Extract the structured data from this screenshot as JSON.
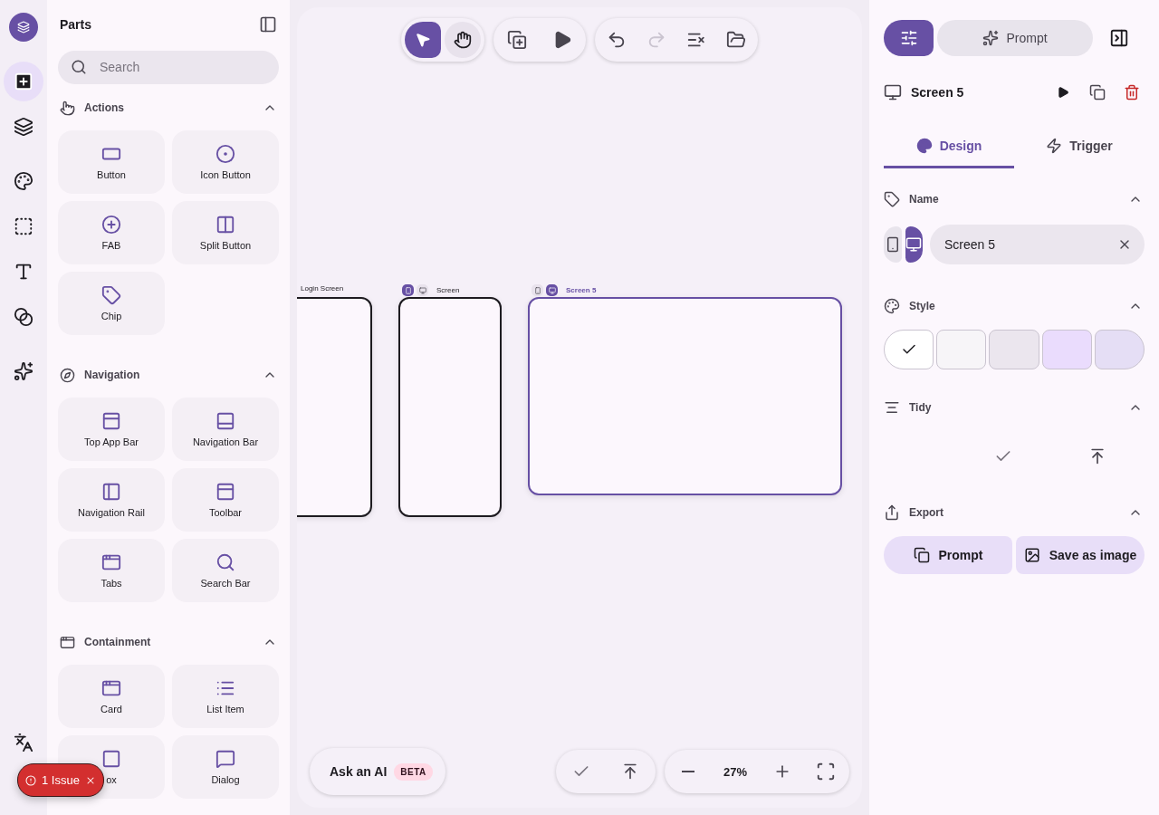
{
  "rail": {
    "items": [
      {
        "selected": true
      },
      {
        "selected": false
      },
      {
        "selected": false
      },
      {
        "selected": false
      },
      {
        "selected": false
      },
      {
        "selected": false
      },
      {
        "selected": false
      }
    ]
  },
  "parts": {
    "title": "Parts",
    "search": {
      "placeholder": "Search"
    },
    "sections": [
      {
        "title": "Actions",
        "expanded": true,
        "items": [
          {
            "label": "Button"
          },
          {
            "label": "Icon Button"
          },
          {
            "label": "FAB"
          },
          {
            "label": "Split Button"
          },
          {
            "label": "Chip"
          }
        ]
      },
      {
        "title": "Navigation",
        "expanded": true,
        "items": [
          {
            "label": "Top App Bar"
          },
          {
            "label": "Navigation Bar"
          },
          {
            "label": "Navigation Rail"
          },
          {
            "label": "Toolbar"
          },
          {
            "label": "Tabs"
          },
          {
            "label": "Search Bar"
          }
        ]
      },
      {
        "title": "Containment",
        "expanded": true,
        "items": [
          {
            "label": "Card"
          },
          {
            "label": "List Item"
          },
          {
            "label": "ox"
          },
          {
            "label": "Dialog"
          }
        ]
      }
    ]
  },
  "canvas": {
    "tools": [
      {
        "selected": true
      },
      {
        "selected": false
      }
    ],
    "actions": [
      {
        "disabled": false
      },
      {
        "disabled": false
      },
      {
        "disabled": false
      },
      {
        "disabled": true
      },
      {
        "disabled": false
      },
      {
        "disabled": false
      }
    ],
    "frames": [
      {
        "label": "Login Screen",
        "selected": false
      },
      {
        "label": "Screen",
        "selected": false,
        "devices": [
          {
            "kind": "phone",
            "selected": true
          },
          {
            "kind": "desktop",
            "selected": false
          }
        ]
      },
      {
        "label": "Screen 5",
        "selected": true,
        "devices": [
          {
            "kind": "phone",
            "selected": false
          },
          {
            "kind": "desktop",
            "selected": true
          }
        ]
      }
    ],
    "ask_ai": {
      "label": "Ask an AI",
      "badge": "BETA"
    },
    "tidy": [
      {
        "disabled": true
      },
      {
        "disabled": false
      }
    ],
    "zoom": "27%"
  },
  "issue": {
    "label": "1 Issue"
  },
  "inspector": {
    "modes": [
      {
        "kind": "settings",
        "selected": true
      },
      {
        "kind": "prompt",
        "label": "Prompt",
        "selected": false
      }
    ],
    "screen": {
      "title": "Screen 5"
    },
    "tabs": [
      {
        "kind": "design",
        "label": "Design",
        "selected": true
      },
      {
        "kind": "trigger",
        "label": "Trigger",
        "selected": false
      }
    ],
    "name": {
      "title": "Name",
      "expanded": true,
      "devices": [
        {
          "kind": "phone",
          "selected": false
        },
        {
          "kind": "desktop",
          "selected": true
        }
      ],
      "value": "Screen 5"
    },
    "style": {
      "title": "Style",
      "expanded": true,
      "swatches": [
        {
          "color": "#ffffff",
          "selected": true
        },
        {
          "color": "#f7f5f8",
          "selected": false
        },
        {
          "color": "#ebe6ee",
          "selected": false
        },
        {
          "color": "#eadcfd",
          "selected": false
        },
        {
          "color": "#e5def5",
          "selected": false
        }
      ]
    },
    "tidy": {
      "title": "Tidy",
      "expanded": true,
      "actions": [
        {
          "disabled": true
        },
        {
          "disabled": false
        }
      ]
    },
    "export": {
      "title": "Export",
      "expanded": true,
      "buttons": [
        {
          "kind": "copy",
          "label": "Prompt"
        },
        {
          "kind": "image",
          "label": "Save as image"
        }
      ]
    }
  }
}
